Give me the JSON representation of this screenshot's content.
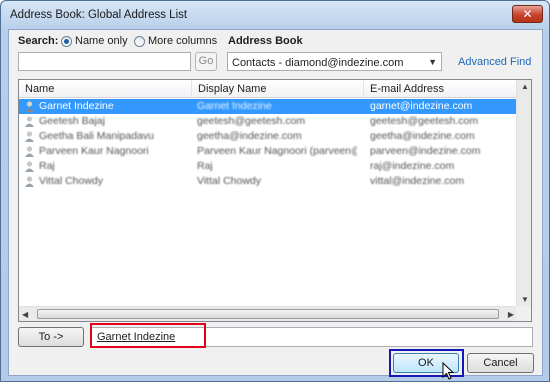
{
  "window": {
    "title": "Address Book: Global Address List",
    "close_glyph": "✕"
  },
  "search": {
    "label": "Search:",
    "option_name_only": "Name only",
    "option_more_columns": "More columns",
    "selected_option": "Name only",
    "input_value": "",
    "go_label": "Go"
  },
  "address_book": {
    "label": "Address Book",
    "selected": "Contacts - diamond@indezine.com",
    "advanced_find": "Advanced Find"
  },
  "list": {
    "columns": [
      "Name",
      "Display Name",
      "E-mail Address"
    ],
    "rows": [
      {
        "name": "Garnet Indezine",
        "display": "Garnet Indezine",
        "email": "garnet@indezine.com",
        "selected": true
      },
      {
        "name": "Geetesh Bajaj",
        "display": "geetesh@geetesh.com",
        "email": "geetesh@geetesh.com",
        "selected": false
      },
      {
        "name": "Geetha Bali Manipadavu",
        "display": "geetha@indezine.com",
        "email": "geetha@indezine.com",
        "selected": false
      },
      {
        "name": "Parveen Kaur Nagnoori",
        "display": "Parveen Kaur Nagnoori (parveen@...",
        "email": "parveen@indezine.com",
        "selected": false
      },
      {
        "name": "Raj",
        "display": "Raj",
        "email": "raj@indezine.com",
        "selected": false
      },
      {
        "name": "Vittal Chowdy",
        "display": "Vittal Chowdy",
        "email": "vittal@indezine.com",
        "selected": false
      }
    ]
  },
  "recipients": {
    "to_label": "To ->",
    "to_value": "Garnet Indezine"
  },
  "buttons": {
    "ok": "OK",
    "cancel": "Cancel"
  },
  "colors": {
    "highlight_red": "#e2001a",
    "highlight_blue": "#1318b6",
    "selection": "#3399ff"
  }
}
